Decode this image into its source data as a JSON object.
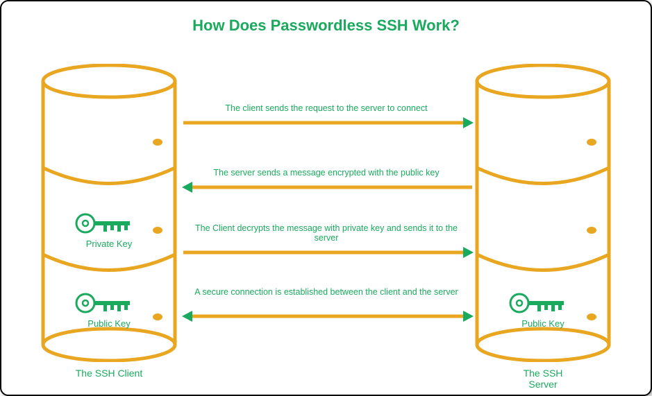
{
  "title": "How Does Passwordless SSH Work?",
  "client": {
    "label": "The SSH Client",
    "keys": {
      "private": "Private Key",
      "public": "Public Key"
    }
  },
  "server": {
    "label": "The SSH Server",
    "keys": {
      "public": "Public Key"
    }
  },
  "steps": [
    {
      "text": "The client sends the request to the server to connect",
      "direction": "right"
    },
    {
      "text": "The server sends a message encrypted with the public key",
      "direction": "left"
    },
    {
      "text": "The Client decrypts the message with private key and sends it to the server",
      "direction": "right"
    },
    {
      "text": "A secure connection is established between the client and the server",
      "direction": "both"
    }
  ],
  "colors": {
    "accent": "#1aaa5d",
    "cylinder": "#e8a621",
    "arrow": "#e8a621"
  }
}
